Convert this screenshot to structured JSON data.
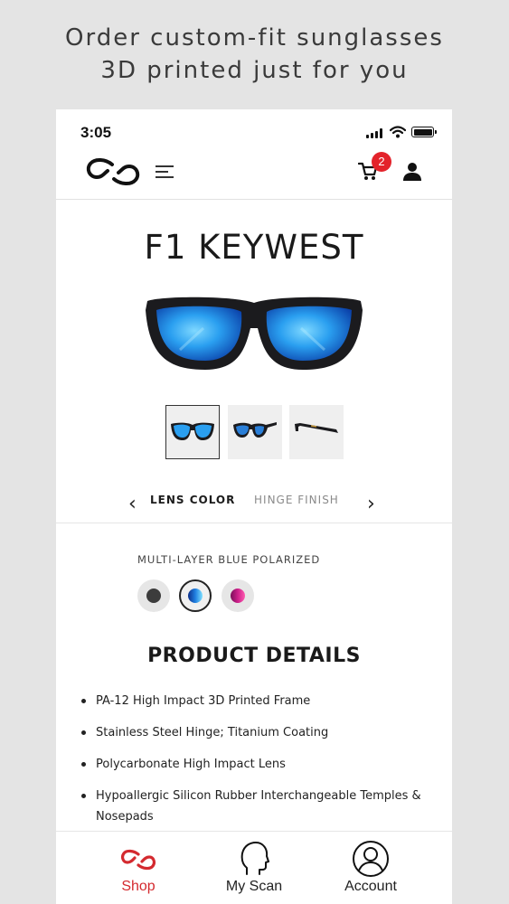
{
  "headline": {
    "line1": "Order custom-fit sunglasses",
    "line2": "3D printed just for you"
  },
  "status_bar": {
    "time": "3:05"
  },
  "header": {
    "logo_icon": "brand-logo-icon",
    "menu_icon": "hamburger-menu-icon",
    "cart_icon": "cart-icon",
    "cart_count": "2",
    "account_icon": "user-icon"
  },
  "product": {
    "title": "F1 KEYWEST",
    "thumbnails": [
      "front-view",
      "angle-view",
      "side-view"
    ],
    "selected_thumbnail": 0
  },
  "options": {
    "tabs": [
      {
        "label": "LENS COLOR",
        "active": true
      },
      {
        "label": "HINGE FINISH",
        "active": false
      }
    ],
    "lens_label": "MULTI-LAYER BLUE POLARIZED",
    "swatches": [
      {
        "name": "smoke",
        "color": "#3c3c3c",
        "selected": false
      },
      {
        "name": "blue",
        "color": "#1f7fe0",
        "selected": true
      },
      {
        "name": "pink",
        "color": "#cc1f8a",
        "selected": false
      }
    ]
  },
  "details": {
    "heading": "PRODUCT DETAILS",
    "items": [
      "PA-12 High Impact 3D Printed Frame",
      "Stainless Steel Hinge; Titanium Coating",
      "Polycarbonate High Impact Lens",
      "Hypoallergic Silicon Rubber Interchangeable Temples & Nosepads"
    ]
  },
  "tab_bar": {
    "items": [
      {
        "label": "Shop",
        "icon": "shop-logo-icon",
        "active": true
      },
      {
        "label": "My Scan",
        "icon": "head-scan-icon",
        "active": false
      },
      {
        "label": "Account",
        "icon": "account-icon",
        "active": false
      }
    ]
  },
  "colors": {
    "accent": "#d42a2f",
    "badge": "#e3232b",
    "lens": "#1f7fe0"
  }
}
